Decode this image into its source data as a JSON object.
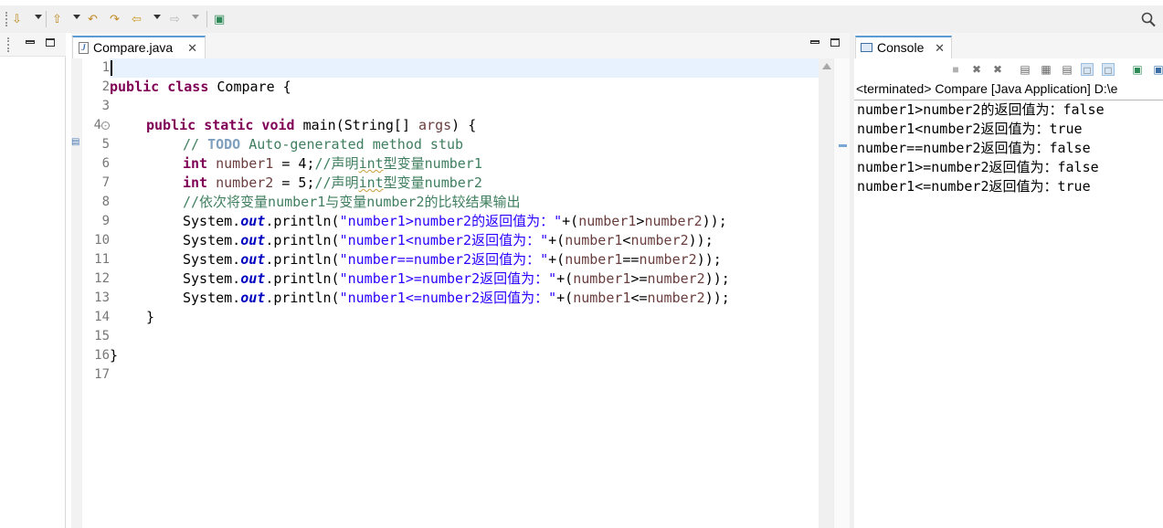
{
  "toolbar": {
    "icons": [
      "next-annotation-icon",
      "previous-annotation-icon",
      "last-edit-location-icon",
      "back-icon",
      "forward-icon",
      "pin-editor-icon",
      "search-icon"
    ]
  },
  "editor": {
    "tab_label": "Compare.java",
    "line_numbers": [
      "1",
      "2",
      "3",
      "4",
      "5",
      "6",
      "7",
      "8",
      "9",
      "10",
      "11",
      "12",
      "13",
      "14",
      "15",
      "16",
      "17"
    ],
    "code": {
      "l2_kw": "public class",
      "l2_rest": " Compare {",
      "l4_kw": "public static void",
      "l4_rest1": " main(String[] ",
      "l4_arg": "args",
      "l4_rest2": ") {",
      "l5_comment1": "// ",
      "l5_todo": "TODO",
      "l5_comment2": " Auto-generated method stub",
      "type_int": "int",
      "l6_var": "number1",
      "l6_rest": " = 4;",
      "l6_c1": "//声明",
      "l6_c2": "int",
      "l6_c3": "型变量number1",
      "l7_var": "number2",
      "l7_rest": " = 5;",
      "l7_c1": "//声明",
      "l7_c2": "int",
      "l7_c3": "型变量number2",
      "l8_comment": "//依次将变量number1与变量number2的比较结果输出",
      "sys": "System.",
      "out": "out",
      "println": ".println(",
      "plus": "+(",
      "close": "));",
      "l9_str": "\"number1>number2的返回值为：\"",
      "l9_a": "number1",
      "l9_op": ">",
      "l9_b": "number2",
      "l10_str": "\"number1<number2返回值为：\"",
      "l10_a": "number1",
      "l10_op": "<",
      "l10_b": "number2",
      "l11_str": "\"number==number2返回值为：\"",
      "l11_a": "number1",
      "l11_op": "==",
      "l11_b": "number2",
      "l12_str": "\"number1>=number2返回值为：\"",
      "l12_a": "number1",
      "l12_op": ">=",
      "l12_b": "number2",
      "l13_str": "\"number1<=number2返回值为：\"",
      "l13_a": "number1",
      "l13_op": "<=",
      "l13_b": "number2",
      "l14": "}",
      "l16": "}"
    }
  },
  "console": {
    "tab_label": "Console",
    "header": "<terminated> Compare [Java Application] D:\\e",
    "output": [
      "number1>number2的返回值为：false",
      "number1<number2返回值为：true",
      "number==number2返回值为：false",
      "number1>=number2返回值为：false",
      "number1<=number2返回值为：true"
    ]
  }
}
